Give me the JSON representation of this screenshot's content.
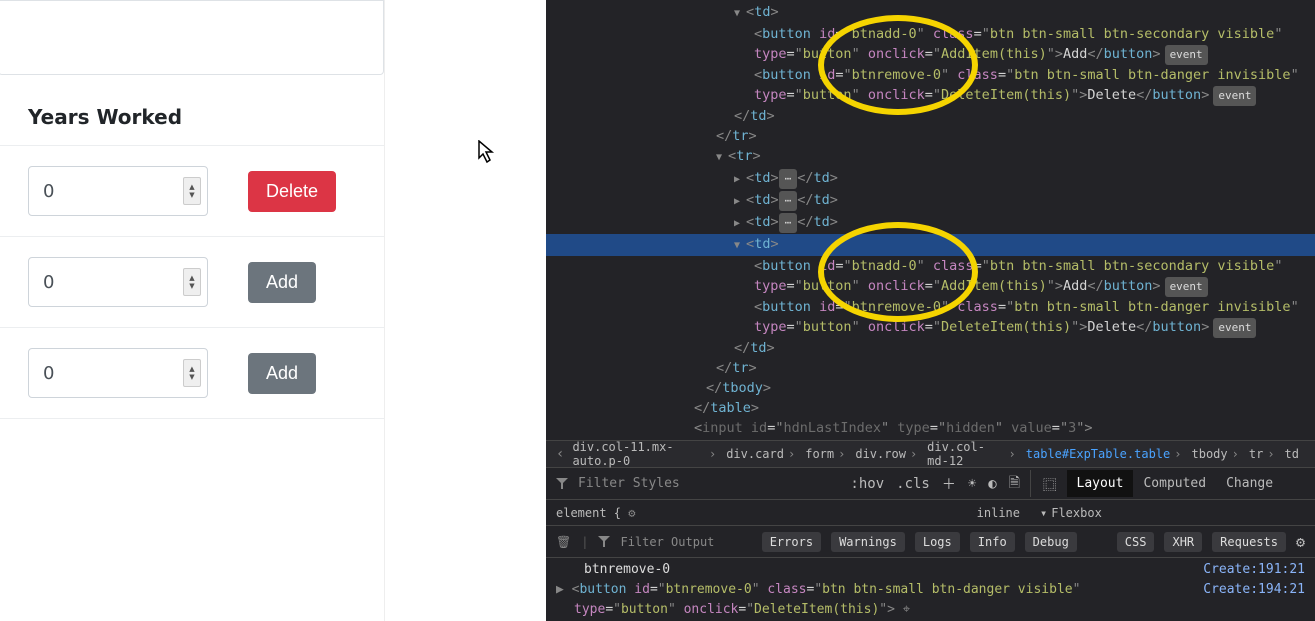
{
  "form": {
    "heading": "Years Worked",
    "rows": [
      {
        "value": "0",
        "button": {
          "kind": "danger",
          "label": "Delete"
        }
      },
      {
        "value": "0",
        "button": {
          "kind": "secondary",
          "label": "Add"
        }
      },
      {
        "value": "0",
        "button": {
          "kind": "secondary",
          "label": "Add"
        }
      }
    ]
  },
  "devtools": {
    "tokens": {
      "button": "button",
      "td": "td",
      "tr": "tr",
      "tbody": "tbody",
      "table": "table",
      "input": "input",
      "id": "id",
      "class": "class",
      "type": "type",
      "onclick": "onclick",
      "value": "value",
      "btnadd0": "btnadd-0",
      "btnremove0": "btnremove-0",
      "cls_add": "btn btn-small btn-secondary visible",
      "cls_del": "btn btn-small btn-danger invisible",
      "cls_del_visible": "btn btn-small btn-danger visible",
      "typeButton": "button",
      "typeHidden": "hidden",
      "onAdd": "AddItem(this)",
      "onDel": "DeleteItem(this)",
      "txtAdd": "Add",
      "txtDelete": "Delete",
      "hdn_id": "hdnLastIndex",
      "hdn_val": "3",
      "eventBadge": "event",
      "dots": "⋯"
    },
    "breadcrumbs": [
      "div.col-11.mx-auto.p-0",
      "div.card",
      "form",
      "div.row",
      "div.col-md-12",
      "table#ExpTable.table",
      "tbody",
      "tr",
      "td"
    ],
    "filterStyles": "Filter Styles",
    "pseudo": {
      "hov": ":hov",
      "cls": ".cls"
    },
    "tabs": {
      "layout": "Layout",
      "computed": "Computed",
      "changes": "Change"
    },
    "element_open": "element {",
    "inline": "inline",
    "flexbox": "Flexbox",
    "filterOutput": "Filter Output",
    "chips": [
      "Errors",
      "Warnings",
      "Logs",
      "Info",
      "Debug"
    ],
    "chips2": [
      "CSS",
      "XHR",
      "Requests"
    ],
    "console": {
      "l1_text": "btnremove-0",
      "l1_loc": "Create:191:21",
      "l2_prefix": "▶ ",
      "l2_loc": "Create:194:21"
    }
  }
}
